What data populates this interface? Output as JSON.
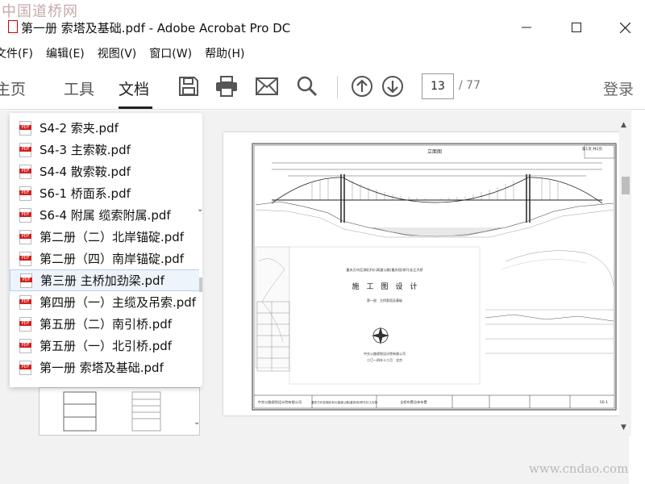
{
  "watermarks": {
    "top": "中国道桥网",
    "bottom": "www.cndao.com"
  },
  "window": {
    "title": "第一册 索塔及基础.pdf - Adobe Acrobat Pro DC",
    "controls": [
      "minimize-icon",
      "maximize-icon",
      "close-icon"
    ]
  },
  "menu": [
    "文件(F)",
    "编辑(E)",
    "视图(V)",
    "窗口(W)",
    "帮助(H)"
  ],
  "toolbar": {
    "tabs": [
      {
        "label": "主页",
        "active": false
      },
      {
        "label": "工具",
        "active": false
      },
      {
        "label": "文档",
        "active": true
      }
    ],
    "icons": [
      "save-icon",
      "print-icon",
      "email-icon",
      "search-icon",
      "page-up-icon",
      "page-down-icon"
    ],
    "current_page": "13",
    "total_pages": "/ 77",
    "login_label": "登录"
  },
  "file_list": {
    "selected_index": 7,
    "items": [
      "S4-2 索夹.pdf",
      "S4-3 主索鞍.pdf",
      "S4-4 散索鞍.pdf",
      "S6-1 桥面系.pdf",
      "S6-4 附属 缆索附属.pdf",
      "第二册（二）北岸锚碇.pdf",
      "第二册（四）南岸锚碇.pdf",
      "第三册 主桥加劲梁.pdf",
      "第四册（一）主缆及吊索.pdf",
      "第五册（二）南引桥.pdf",
      "第五册（一）北引桥.pdf",
      "第一册 索塔及基础.pdf"
    ]
  },
  "document": {
    "drawing_title": "立面图",
    "cover_heading": "施　工　图　设　计",
    "cover_project": "重庆万州至湖北利川高速公路(重庆段)驸马长江大桥",
    "cover_volume": "第一册　主桥索塔及基础",
    "cover_company": "中交公路规划设计院有限公司",
    "cover_date": "二〇一四年十二月　北京",
    "footer_company": "中交公路规划设计院有限公司",
    "footer_project": "重庆万州至湖北利川高速公路(重庆段)驸马长江大桥",
    "footer_sheet": "全桥布置总体布置",
    "footer_code": "S0-1",
    "sheet_index": "第1页 共2页"
  },
  "colors": {
    "pdf_red": "#d41f1f",
    "selection_bg": "#eef4fb",
    "selection_border": "#b7cfe8"
  }
}
